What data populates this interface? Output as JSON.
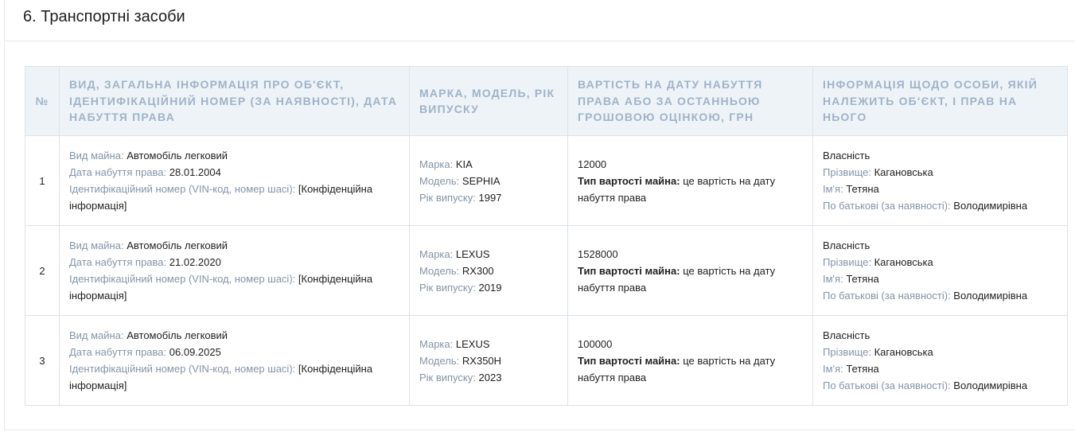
{
  "section": {
    "title": "6. Транспортні засоби"
  },
  "table": {
    "headers": {
      "num": "№",
      "object": "Вид, загальна інформація про об'єкт, ідентифікаційний номер (за наявності), дата набуття права",
      "brand": "Марка, модель, рік випуску",
      "value": "Вартість на дату набуття права або за останньою грошовою оцінкою, грн",
      "owner": "Інформація щодо особи, якій належить об'єкт, і прав на нього"
    },
    "labels": {
      "property_type": "Вид майна:",
      "acquire_date": "Дата набуття права:",
      "vin": "Ідентифікаційний номер (VIN-код, номер шасі):",
      "brand": "Марка:",
      "model": "Модель:",
      "year": "Рік випуску:",
      "value_type": "Тип вартості майна:",
      "surname": "Прізвище:",
      "name": "Ім'я:",
      "patronymic": "По батькові (за наявності):"
    },
    "rows": [
      {
        "num": "1",
        "property_type": "Автомобіль легковий",
        "acquire_date": "28.01.2004",
        "vin": "[Конфіденційна інформація]",
        "brand": "KIA",
        "model": "SEPHIA",
        "year": "1997",
        "value": "12000",
        "value_type": "це вартість на дату набуття права",
        "right": "Власність",
        "surname": "Кагановська",
        "name": "Тетяна",
        "patronymic": "Володимирівна"
      },
      {
        "num": "2",
        "property_type": "Автомобіль легковий",
        "acquire_date": "21.02.2020",
        "vin": "[Конфіденційна інформація]",
        "brand": "LEXUS",
        "model": "RX300",
        "year": "2019",
        "value": "1528000",
        "value_type": "це вартість на дату набуття права",
        "right": "Власність",
        "surname": "Кагановська",
        "name": "Тетяна",
        "patronymic": "Володимирівна"
      },
      {
        "num": "3",
        "property_type": "Автомобіль легковий",
        "acquire_date": "06.09.2025",
        "vin": "[Конфіденційна інформація]",
        "brand": "LEXUS",
        "model": "RX350H",
        "year": "2023",
        "value": "100000",
        "value_type": "це вартість на дату набуття права",
        "right": "Власність",
        "surname": "Кагановська",
        "name": "Тетяна",
        "patronymic": "Володимирівна"
      }
    ]
  }
}
